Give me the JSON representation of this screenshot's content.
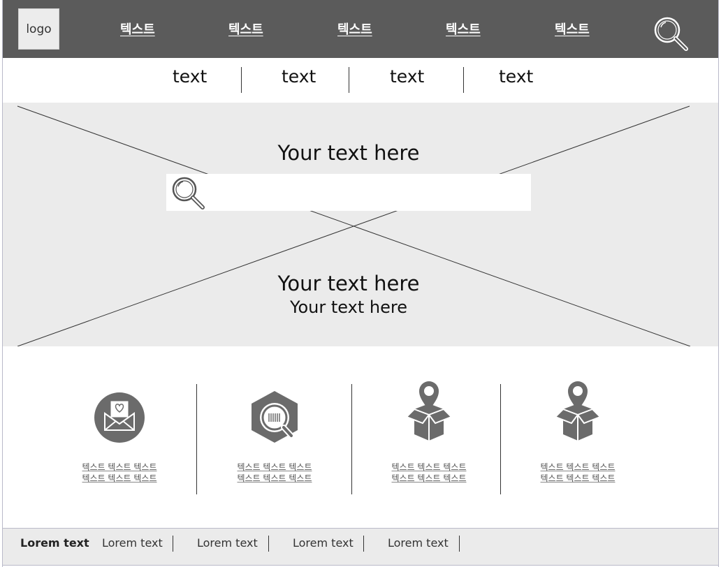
{
  "header": {
    "logo_label": "logo",
    "nav": [
      "텍스트",
      "텍스트",
      "텍스트",
      "텍스트",
      "텍스트"
    ],
    "search_icon": "search-icon"
  },
  "subnav": [
    "text",
    "text",
    "text",
    "text"
  ],
  "hero": {
    "title": "Your text here",
    "search_placeholder": "",
    "headline": "Your text here",
    "subheadline": "Your text here",
    "background_color": "#ebebeb"
  },
  "features": [
    {
      "icon": "love-letter-icon",
      "line1": "텍스트 텍스트 텍스트",
      "line2": "텍스트 텍스트 텍스트"
    },
    {
      "icon": "barcode-search-icon",
      "line1": "텍스트 텍스트 텍스트",
      "line2": "텍스트 텍스트 텍스트"
    },
    {
      "icon": "box-location-icon",
      "line1": "텍스트 텍스트 텍스트",
      "line2": "텍스트 텍스트 텍스트"
    },
    {
      "icon": "box-location-icon",
      "line1": "텍스트 텍스트 텍스트",
      "line2": "텍스트 텍스트 텍스트"
    }
  ],
  "footer": {
    "items": [
      "Lorem text",
      "Lorem text",
      "Lorem text",
      "Lorem text",
      "Lorem text"
    ]
  },
  "colors": {
    "topbar": "#5b5b5b",
    "icon_gray": "#6b6b6b"
  }
}
